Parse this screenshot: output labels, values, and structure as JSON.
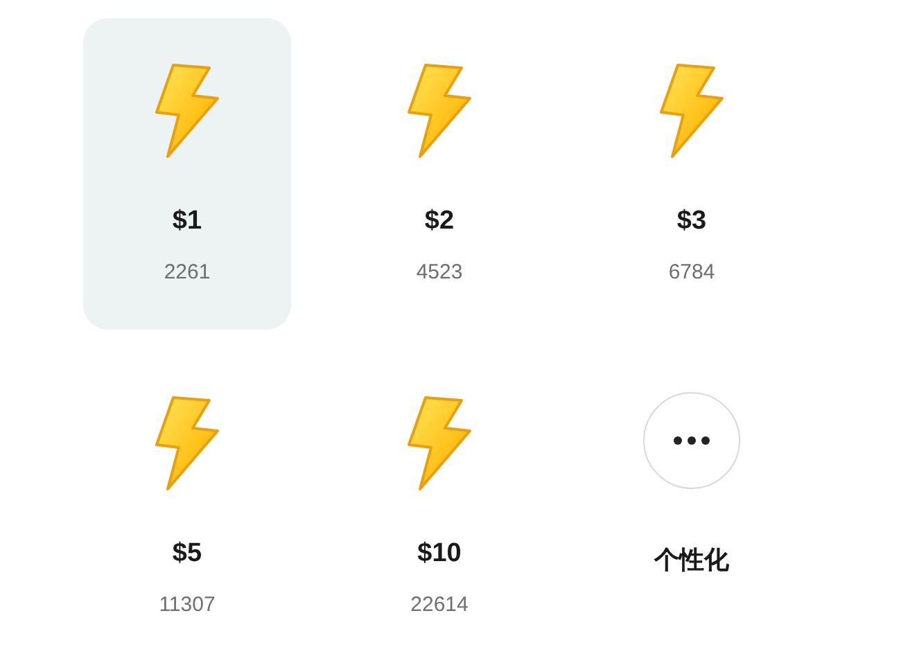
{
  "options": [
    {
      "kind": "amount",
      "price": "$1",
      "count": "2261",
      "selected": true
    },
    {
      "kind": "amount",
      "price": "$2",
      "count": "4523",
      "selected": false
    },
    {
      "kind": "amount",
      "price": "$3",
      "count": "6784",
      "selected": false
    },
    {
      "kind": "amount",
      "price": "$5",
      "count": "11307",
      "selected": false
    },
    {
      "kind": "amount",
      "price": "$10",
      "count": "22614",
      "selected": false
    },
    {
      "kind": "custom",
      "label": "个性化",
      "selected": false
    }
  ]
}
